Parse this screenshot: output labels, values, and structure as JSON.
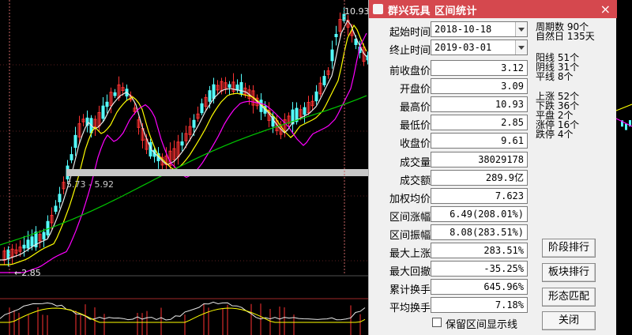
{
  "chart": {
    "high_label": "10.93",
    "low_label": "2.85",
    "range_label": "5.73 - 5.92",
    "colors": {
      "up": "#ff3232",
      "down": "#54ffff",
      "ma_white": "#e8e8e8",
      "ma_yellow": "#ffff00",
      "ma_magenta": "#ff00ff",
      "ma_green": "#00c800",
      "band": "#c8c8c8"
    }
  },
  "dialog": {
    "title": "群兴玩具 区间统计",
    "close_glyph": "×",
    "start_label": "起始时间",
    "start_value": "2018-10-18",
    "end_label": "终止时间",
    "end_value": "2019-03-01",
    "fields": [
      {
        "label": "前收盘价",
        "value": "3.12"
      },
      {
        "label": "开盘价",
        "value": "3.09"
      },
      {
        "label": "最高价",
        "value": "10.93"
      },
      {
        "label": "最低价",
        "value": "2.85"
      },
      {
        "label": "收盘价",
        "value": "9.61"
      },
      {
        "label": "成交量",
        "value": "38029178"
      },
      {
        "label": "成交额",
        "value": "289.9亿"
      },
      {
        "label": "加权均价",
        "value": "7.623"
      },
      {
        "label": "区间涨幅",
        "value": "6.49(208.01%)"
      },
      {
        "label": "区间振幅",
        "value": "8.08(283.51%)"
      },
      {
        "label": "最大上涨",
        "value": "283.51%"
      },
      {
        "label": "最大回撤",
        "value": "-35.25%"
      },
      {
        "label": "累计换手",
        "value": "645.96%"
      },
      {
        "label": "平均换手",
        "value": "7.18%"
      }
    ],
    "stats": {
      "period_count": "周期数  90个",
      "natural_days": "自然日  135天",
      "yang": "阳线  51个",
      "yin": "阴线  31个",
      "flat": "平线  8个",
      "up": "上涨  52个",
      "down": "下跌  36个",
      "level": "平盘  2个",
      "limit_up": "涨停  16个",
      "limit_down": "跌停  4个"
    },
    "buttons": {
      "stage_rank": "阶段排行",
      "sector_rank": "板块排行",
      "pattern_match": "形态匹配",
      "close": "关闭"
    },
    "checkbox_label": "保留区间显示线"
  }
}
